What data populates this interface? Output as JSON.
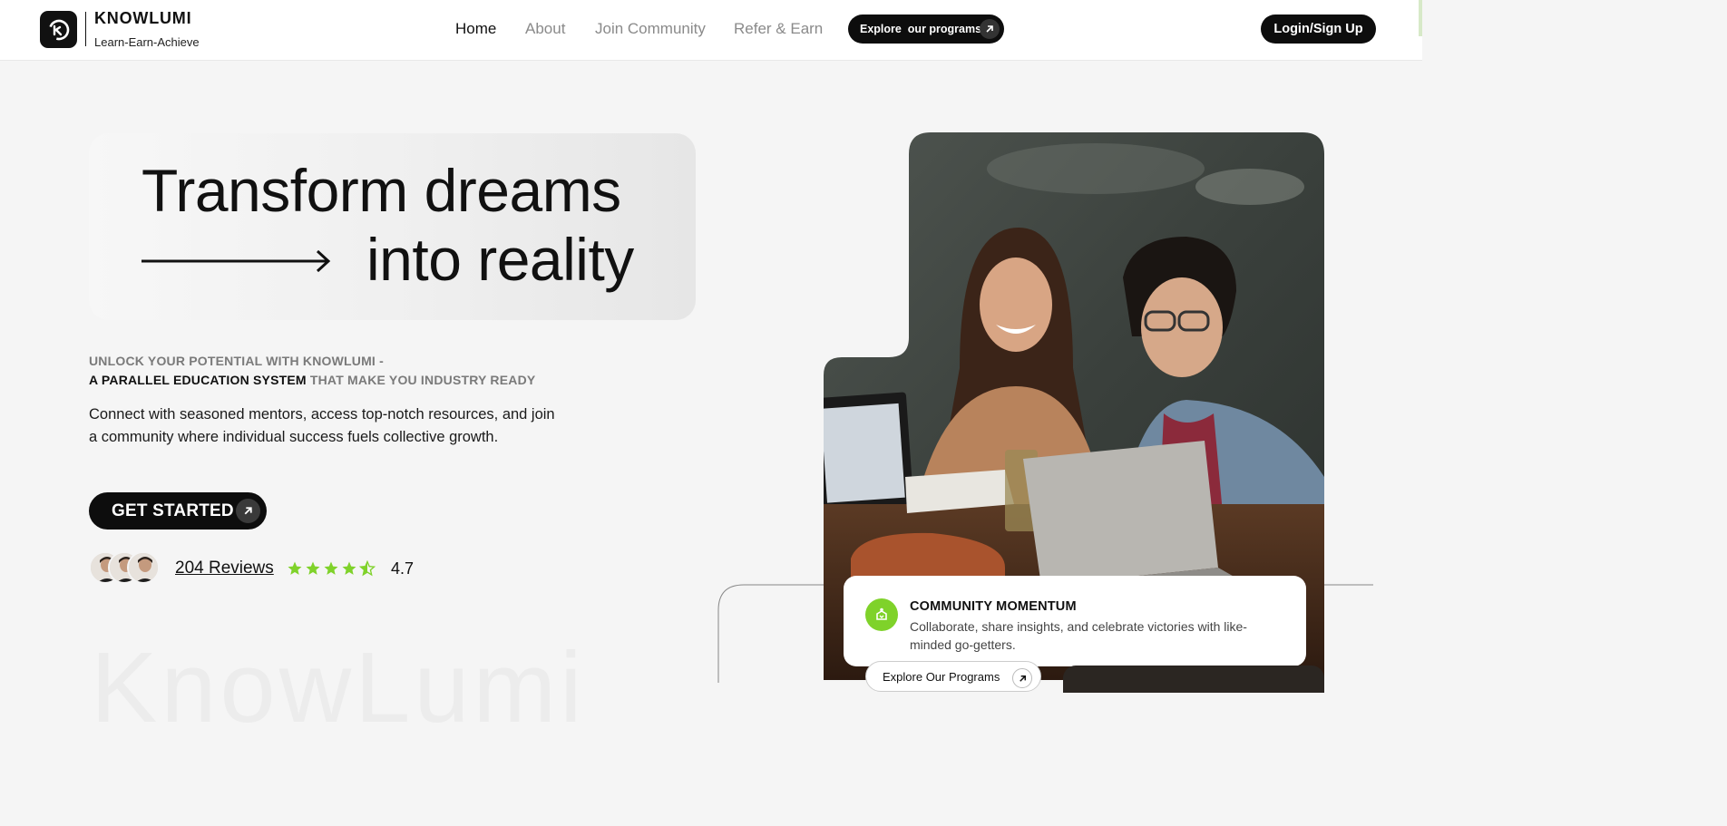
{
  "header": {
    "brand_name": "KNOWLUMI",
    "brand_tagline": "Learn-Earn-Achieve",
    "nav": [
      {
        "label": "Home"
      },
      {
        "label": "About"
      },
      {
        "label": "Join Community"
      },
      {
        "label": "Refer & Earn"
      }
    ],
    "explore_label": "Explore  our programs",
    "login_label": "Login/Sign Up"
  },
  "hero": {
    "headline_line1": "Transform dreams",
    "headline_line2": "into reality",
    "eyebrow_line1": "UNLOCK YOUR POTENTIAL WITH KNOWLUMI -",
    "eyebrow_line2_bold": "A PARALLEL EDUCATION SYSTEM",
    "eyebrow_line2_rest": "THAT MAKE YOU INDUSTRY READY",
    "lead": "Connect with seasoned mentors, access top-notch resources, and join a community where individual success fuels collective growth.",
    "cta_label": "GET STARTED",
    "reviews_label": "204 Reviews",
    "rating": "4.7",
    "stars_shown": 4.5,
    "watermark": "KnowLumi"
  },
  "community": {
    "title": "COMMUNITY MOMENTUM",
    "text": "Collaborate, share insights, and celebrate victories with like-minded go-getters.",
    "button_label": "Explore Our Programs"
  },
  "colors": {
    "accent_green": "#7fd22a",
    "dark": "#0d0d0d",
    "muted_nav": "#8a8a8a"
  },
  "icons": [
    "logo-icon",
    "arrow-up-right-icon",
    "long-arrow-right-icon",
    "star-icon",
    "half-star-icon",
    "community-icon"
  ]
}
